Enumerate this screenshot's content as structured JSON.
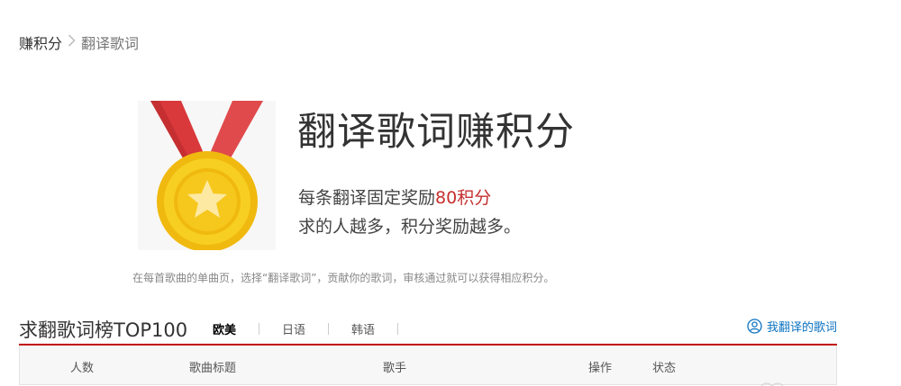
{
  "breadcrumb": {
    "parent": "赚积分",
    "separator": ">",
    "current": "翻译歌词"
  },
  "hero": {
    "title": "翻译歌词赚积分",
    "line1_prefix": "每条翻译固定奖励",
    "line1_highlight": "80积分",
    "line2": "求的人越多，积分奖励越多。",
    "medal_icon": "gold-medal-star"
  },
  "hint": "在每首歌曲的单曲页，选择“翻译歌词”，贡献你的歌词，审核通过就可以获得相应积分。",
  "board": {
    "title": "求翻歌词榜TOP100",
    "tabs": [
      {
        "label": "欧美",
        "active": true
      },
      {
        "label": "日语",
        "active": false
      },
      {
        "label": "韩语",
        "active": false
      }
    ],
    "my_translations": "我翻译的歌词",
    "my_icon": "user-circle-icon"
  },
  "table": {
    "columns": [
      "人数",
      "歌曲标题",
      "歌手",
      "操作",
      "状态"
    ]
  },
  "colors": {
    "accent_red": "#c20c0c",
    "highlight_red": "#c62f2f",
    "link_blue": "#0c73c2",
    "medal_gold": "#f5c518",
    "ribbon_red": "#d9393b"
  }
}
